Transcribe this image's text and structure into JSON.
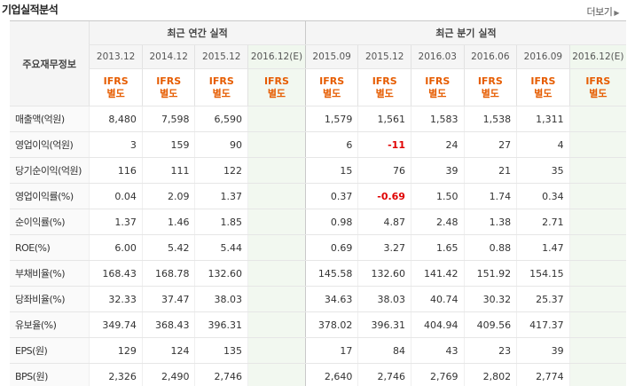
{
  "header": {
    "title": "기업실적분석",
    "more_label": "더보기"
  },
  "table": {
    "corner_label": "주요재무정보",
    "annual_group_label": "최근 연간 실적",
    "quarter_group_label": "최근 분기 실적",
    "annual_dates": [
      "2013.12",
      "2014.12",
      "2015.12",
      "2016.12(E)"
    ],
    "quarter_dates": [
      "2015.09",
      "2015.12",
      "2016.03",
      "2016.06",
      "2016.09",
      "2016.12(E)"
    ],
    "ifrs_line1": "IFRS",
    "ifrs_line2": "별도",
    "rows": [
      {
        "label": "매출액(억원)",
        "annual": [
          "8,480",
          "7,598",
          "6,590",
          ""
        ],
        "quarter": [
          "1,579",
          "1,561",
          "1,583",
          "1,538",
          "1,311",
          ""
        ]
      },
      {
        "label": "영업이익(억원)",
        "annual": [
          "3",
          "159",
          "90",
          ""
        ],
        "quarter": [
          "6",
          "-11",
          "24",
          "27",
          "4",
          ""
        ]
      },
      {
        "label": "당기순이익(억원)",
        "annual": [
          "116",
          "111",
          "122",
          ""
        ],
        "quarter": [
          "15",
          "76",
          "39",
          "21",
          "35",
          ""
        ]
      },
      {
        "label": "영업이익률(%)",
        "annual": [
          "0.04",
          "2.09",
          "1.37",
          ""
        ],
        "quarter": [
          "0.37",
          "-0.69",
          "1.50",
          "1.74",
          "0.34",
          ""
        ]
      },
      {
        "label": "순이익률(%)",
        "annual": [
          "1.37",
          "1.46",
          "1.85",
          ""
        ],
        "quarter": [
          "0.98",
          "4.87",
          "2.48",
          "1.38",
          "2.71",
          ""
        ]
      },
      {
        "label": "ROE(%)",
        "annual": [
          "6.00",
          "5.42",
          "5.44",
          ""
        ],
        "quarter": [
          "0.69",
          "3.27",
          "1.65",
          "0.88",
          "1.47",
          ""
        ]
      },
      {
        "label": "부채비율(%)",
        "annual": [
          "168.43",
          "168.78",
          "132.60",
          ""
        ],
        "quarter": [
          "145.58",
          "132.60",
          "141.42",
          "151.92",
          "154.15",
          ""
        ]
      },
      {
        "label": "당좌비율(%)",
        "annual": [
          "32.33",
          "37.47",
          "38.03",
          ""
        ],
        "quarter": [
          "34.63",
          "38.03",
          "40.74",
          "30.32",
          "25.37",
          ""
        ]
      },
      {
        "label": "유보율(%)",
        "annual": [
          "349.74",
          "368.43",
          "396.31",
          ""
        ],
        "quarter": [
          "378.02",
          "396.31",
          "404.94",
          "409.56",
          "417.37",
          ""
        ]
      },
      {
        "label": "EPS(원)",
        "annual": [
          "129",
          "124",
          "135",
          ""
        ],
        "quarter": [
          "17",
          "84",
          "43",
          "23",
          "39",
          ""
        ]
      },
      {
        "label": "BPS(원)",
        "annual": [
          "2,326",
          "2,490",
          "2,746",
          ""
        ],
        "quarter": [
          "2,640",
          "2,746",
          "2,769",
          "2,802",
          "2,774",
          ""
        ]
      }
    ],
    "colors": {
      "negative": "#e00000",
      "ifrs": "#e65c00",
      "estimate": "#2e8b57"
    }
  }
}
